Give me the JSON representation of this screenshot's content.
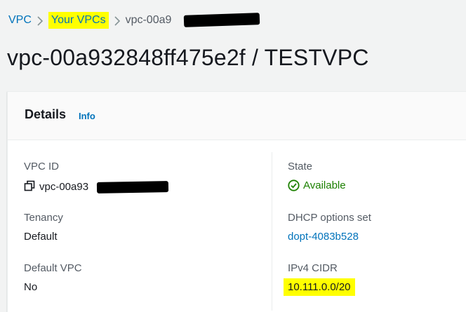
{
  "breadcrumb": {
    "root": "VPC",
    "section": "Your VPCs",
    "current": "vpc-00a9"
  },
  "title": "vpc-00a932848ff475e2f / TESTVPC",
  "details": {
    "heading": "Details",
    "info": "Info",
    "vpc_id_label": "VPC ID",
    "vpc_id_value": "vpc-00a93",
    "tenancy_label": "Tenancy",
    "tenancy_value": "Default",
    "default_vpc_label": "Default VPC",
    "default_vpc_value": "No",
    "state_label": "State",
    "state_value": "Available",
    "dhcp_label": "DHCP options set",
    "dhcp_value": "dopt-4083b528",
    "cidr_label": "IPv4 CIDR",
    "cidr_value": "10.111.0.0/20"
  },
  "colors": {
    "link": "#0073bb",
    "success": "#1d8102",
    "highlight": "#ffff00",
    "redaction": "#000000"
  },
  "icons": {
    "breadcrumb_separator": "chevron-right-icon",
    "state": "check-circle-icon",
    "vpc_id": "copy-icon"
  }
}
